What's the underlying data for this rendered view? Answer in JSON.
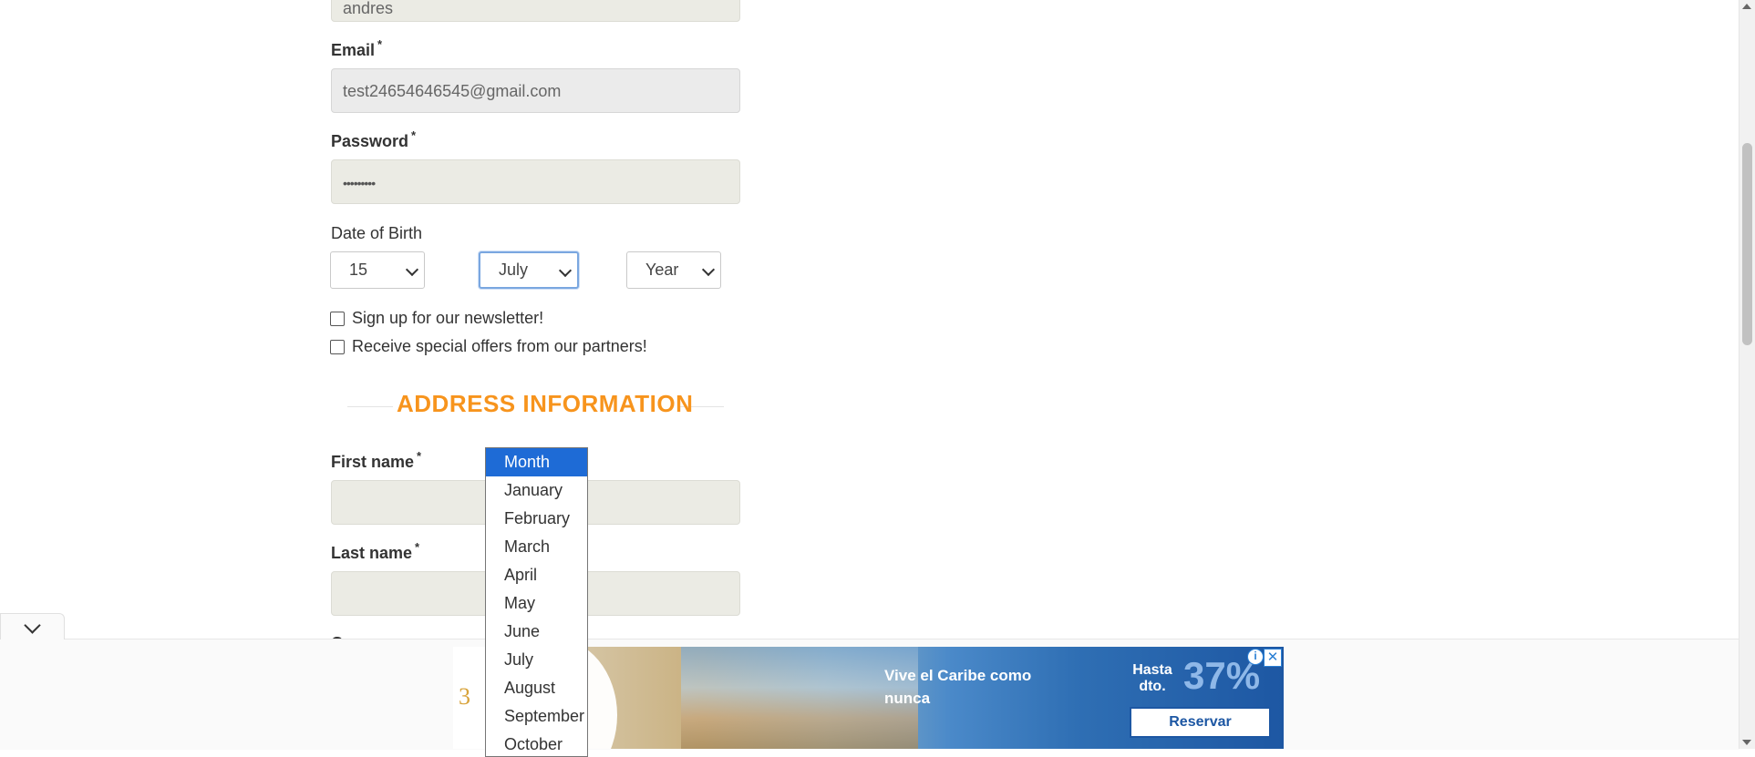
{
  "form": {
    "username_partial": "andres",
    "email": {
      "label": "Email",
      "required": "*",
      "value": "test24654646545@gmail.com"
    },
    "password": {
      "label": "Password",
      "required": "*",
      "value": "•••••••••"
    },
    "dob": {
      "label": "Date of Birth",
      "day": "15",
      "month": "July",
      "year": "Year"
    },
    "newsletter_label": "Sign up for our newsletter!",
    "offers_label": "Receive special offers from our partners!",
    "address_title": "ADDRESS INFORMATION",
    "first_name": {
      "label": "First name",
      "required": "*",
      "value": ""
    },
    "last_name": {
      "label": "Last name",
      "required": "*",
      "value": ""
    },
    "next_label_partial": "C"
  },
  "month_dropdown": {
    "options": [
      "Month",
      "January",
      "February",
      "March",
      "April",
      "May",
      "June",
      "July",
      "August",
      "September",
      "October"
    ],
    "highlighted": "Month"
  },
  "ad": {
    "logo": "3",
    "headline": "Vive el Caribe como nunca",
    "hasta": "Hasta dto.",
    "percent": "37%",
    "cta": "Reservar",
    "info_icon": "i",
    "close_icon": "✕"
  },
  "colors": {
    "accent_orange": "#f7941d",
    "dropdown_highlight": "#1e6bd6",
    "ad_blue": "#1d57a3"
  }
}
